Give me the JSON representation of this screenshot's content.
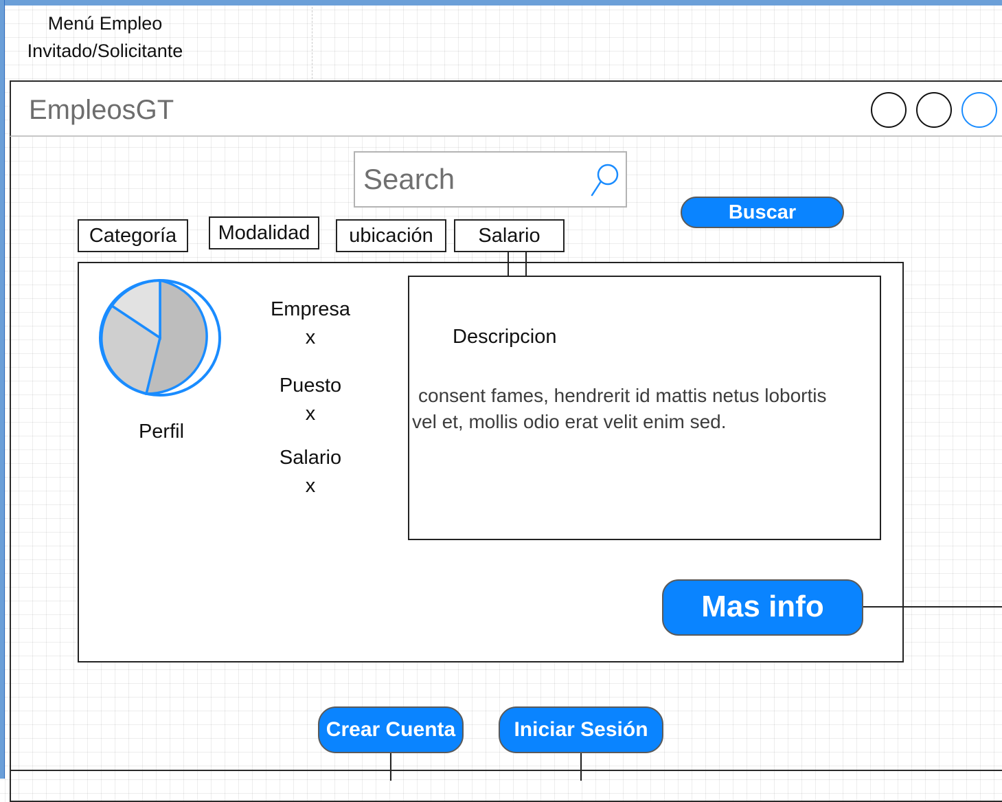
{
  "diagram": {
    "menu_caption_line1": "Menú Empleo",
    "menu_caption_line2": "Invitado/Solicitante"
  },
  "window": {
    "app_title": "EmpleosGT",
    "controls": [
      "circle-black",
      "circle-black",
      "circle-blue"
    ]
  },
  "search": {
    "placeholder": "Search",
    "value": "",
    "icon": "search-icon",
    "button_label": "Buscar"
  },
  "filters": [
    {
      "label": "Categoría"
    },
    {
      "label": "Modalidad"
    },
    {
      "label": "ubicación"
    },
    {
      "label": "Salario"
    }
  ],
  "job_card": {
    "profile_label": "Perfil",
    "profile_icon": "pie-chart-icon",
    "fields": [
      {
        "label": "Empresa",
        "value": "x"
      },
      {
        "label": "Puesto",
        "value": "x"
      },
      {
        "label": "Salario",
        "value": "x"
      }
    ],
    "description_title": "Descripcion",
    "description_text_line1": "consent fames, hendrerit id mattis netus lobortis",
    "description_text_line2": "vel et, mollis odio erat velit enim sed.",
    "more_info_label": "Mas info"
  },
  "footer_actions": {
    "create_account_label": "Crear Cuenta",
    "login_label": "Iniciar Sesión"
  },
  "colors": {
    "accent": "#0a84ff",
    "editor_chrome": "#6b9fd8",
    "pie_fill_dark": "#bdbdbd",
    "pie_fill_mid": "#cfcfcf",
    "pie_fill_light": "#e2e2e2",
    "pie_stroke": "#1a8cff"
  }
}
